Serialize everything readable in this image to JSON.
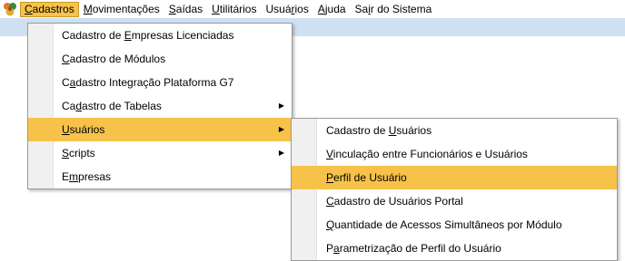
{
  "menubar": {
    "items": [
      {
        "pre": "",
        "u": "C",
        "post": "adastros"
      },
      {
        "pre": "",
        "u": "M",
        "post": "ovimentações"
      },
      {
        "pre": "",
        "u": "S",
        "post": "aídas"
      },
      {
        "pre": "",
        "u": "U",
        "post": "tilitários"
      },
      {
        "pre": "Usuá",
        "u": "r",
        "post": "ios"
      },
      {
        "pre": "",
        "u": "A",
        "post": "juda"
      },
      {
        "pre": "Sa",
        "u": "i",
        "post": "r do Sistema"
      }
    ]
  },
  "cadastros_menu": {
    "items": [
      {
        "pre": "Cadastro de ",
        "u": "E",
        "post": "mpresas Licenciadas"
      },
      {
        "pre": "",
        "u": "C",
        "post": "adastro de Módulos"
      },
      {
        "pre": "C",
        "u": "a",
        "post": "dastro Integração Plataforma G7"
      },
      {
        "pre": "Ca",
        "u": "d",
        "post": "astro de Tabelas"
      },
      {
        "pre": "",
        "u": "U",
        "post": "suários"
      },
      {
        "pre": "",
        "u": "S",
        "post": "cripts"
      },
      {
        "pre": "E",
        "u": "m",
        "post": "presas"
      }
    ]
  },
  "usuarios_menu": {
    "items": [
      {
        "pre": "Cadastro de ",
        "u": "U",
        "post": "suários"
      },
      {
        "pre": "",
        "u": "V",
        "post": "inculação entre Funcionários e Usuários"
      },
      {
        "pre": "",
        "u": "P",
        "post": "erfil de Usuário"
      },
      {
        "pre": "",
        "u": "C",
        "post": "adastro de Usuários Portal"
      },
      {
        "pre": "",
        "u": "Q",
        "post": "uantidade de Acessos Simultâneos por Módulo"
      },
      {
        "pre": "P",
        "u": "a",
        "post": "rametrização de Perfil do Usuário"
      }
    ]
  },
  "colors": {
    "highlight": "#f6c24a",
    "band": "#cfe0f2"
  },
  "icons": {
    "app": "app-logo-icon",
    "submenu": "chevron-right-icon"
  }
}
